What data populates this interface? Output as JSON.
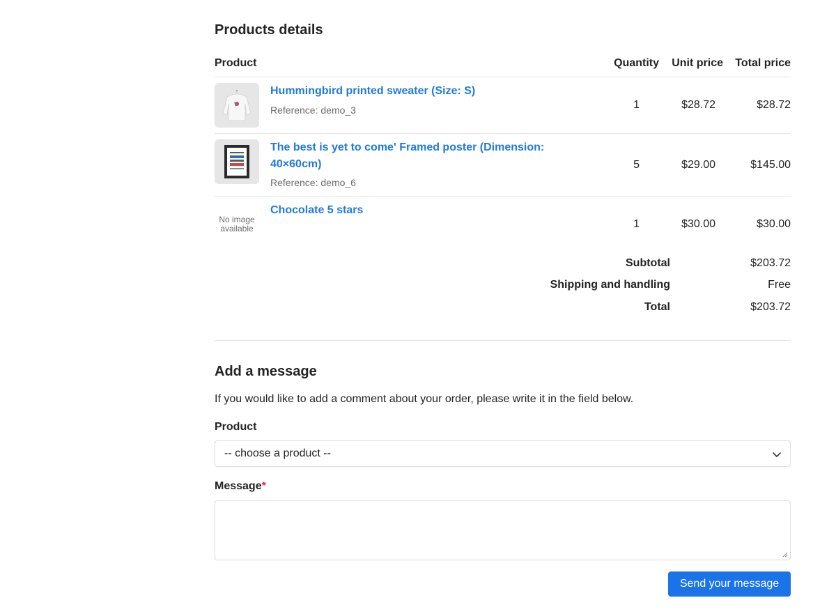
{
  "products": {
    "title": "Products details",
    "columns": {
      "product": "Product",
      "quantity": "Quantity",
      "unit_price": "Unit price",
      "total_price": "Total price"
    },
    "items": [
      {
        "name": "Hummingbird printed sweater (Size: S)",
        "reference": "Reference: demo_3",
        "quantity": "1",
        "unit_price": "$28.72",
        "total_price": "$28.72",
        "image": "sweater-image"
      },
      {
        "name": "The best is yet to come' Framed poster (Dimension: 40×60cm)",
        "reference": "Reference: demo_6",
        "quantity": "5",
        "unit_price": "$29.00",
        "total_price": "$145.00",
        "image": "poster-image"
      },
      {
        "name": "Chocolate 5 stars",
        "reference": "",
        "quantity": "1",
        "unit_price": "$30.00",
        "total_price": "$30.00",
        "image_placeholder": "No image available"
      }
    ],
    "summary": {
      "subtotal_label": "Subtotal",
      "subtotal_value": "$203.72",
      "shipping_label": "Shipping and handling",
      "shipping_value": "Free",
      "total_label": "Total",
      "total_value": "$203.72"
    }
  },
  "message": {
    "title": "Add a message",
    "description": "If you would like to add a comment about your order, please write it in the field below.",
    "product_label": "Product",
    "product_select_value": "-- choose a product --",
    "message_label": "Message",
    "required_mark": "*",
    "message_value": "",
    "send_label": "Send your message"
  },
  "colors": {
    "link": "#1f7ae0",
    "button": "#1a73e8",
    "required": "#e0263b"
  }
}
